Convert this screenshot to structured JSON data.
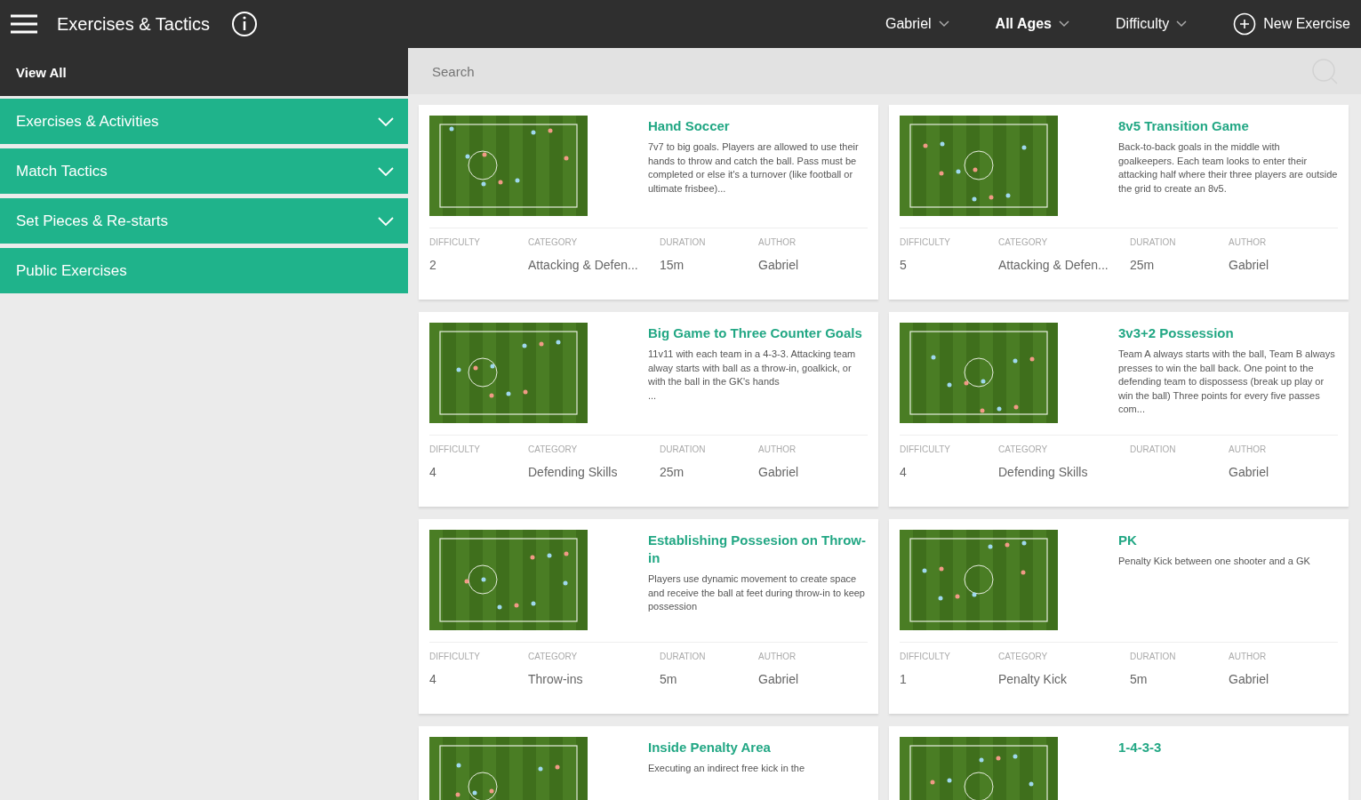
{
  "header": {
    "title": "Exercises & Tactics",
    "filters": [
      {
        "label": "Gabriel",
        "active": false
      },
      {
        "label": "All Ages",
        "active": true
      },
      {
        "label": "Difficulty",
        "active": false
      }
    ],
    "new_button": "New Exercise"
  },
  "sidebar": {
    "view_all": "View All",
    "items": [
      {
        "label": "Exercises & Activities",
        "kind": "group"
      },
      {
        "label": "Match Tactics",
        "kind": "group"
      },
      {
        "label": "Set Pieces & Re-starts",
        "kind": "group"
      },
      {
        "label": "Public Exercises",
        "kind": "link"
      }
    ]
  },
  "search": {
    "placeholder": "Search"
  },
  "cards": [
    {
      "title": "Hand Soccer",
      "description": "7v7 to big goals. Players are allowed to use their hands to throw and catch the ball. Pass must be completed or else it's a turnover (like football or ultimate frisbee)...",
      "fields": [
        {
          "label": "DIFFICULTY",
          "value": "2"
        },
        {
          "label": "CATEGORY",
          "value": "Attacking & Defen..."
        },
        {
          "label": "DURATION",
          "value": "15m"
        },
        {
          "label": "AUTHOR",
          "value": "Gabriel"
        }
      ]
    },
    {
      "title": "8v5 Transition Game",
      "description": "Back-to-back goals in the middle with goalkeepers. Each team looks to enter their attacking half where their three players are outside the grid to create an 8v5.",
      "fields": [
        {
          "label": "DIFFICULTY",
          "value": "5"
        },
        {
          "label": "CATEGORY",
          "value": "Attacking & Defen..."
        },
        {
          "label": "DURATION",
          "value": "25m"
        },
        {
          "label": "AUTHOR",
          "value": "Gabriel"
        }
      ]
    },
    {
      "title": "Big Game to Three Counter Goals",
      "description": "11v11 with each team in a 4-3-3. Attacking team alway starts with ball as a throw-in, goalkick, or with the ball in the GK's hands\n...",
      "fields": [
        {
          "label": "DIFFICULTY",
          "value": "4"
        },
        {
          "label": "CATEGORY",
          "value": "Defending Skills"
        },
        {
          "label": "DURATION",
          "value": "25m"
        },
        {
          "label": "AUTHOR",
          "value": "Gabriel"
        }
      ]
    },
    {
      "title": "3v3+2 Possession",
      "description": "Team A always starts with the ball, Team B always presses to win the ball back. One point to the defending team to dispossess (break up play or win the ball) Three points for every five passes com...",
      "fields": [
        {
          "label": "DIFFICULTY",
          "value": "4"
        },
        {
          "label": "CATEGORY",
          "value": "Defending Skills"
        },
        {
          "label": "DURATION"
        },
        {
          "label": "AUTHOR",
          "value": "Gabriel"
        }
      ]
    },
    {
      "title": "Establishing Possesion on Throw-in",
      "description": "Players use dynamic movement to create space and receive the ball at feet during throw-in to keep possession",
      "fields": [
        {
          "label": "DIFFICULTY",
          "value": "4"
        },
        {
          "label": "CATEGORY",
          "value": "Throw-ins"
        },
        {
          "label": "DURATION",
          "value": "5m"
        },
        {
          "label": "AUTHOR",
          "value": "Gabriel"
        }
      ]
    },
    {
      "title": "PK",
      "description": "Penalty Kick between one shooter and a GK",
      "fields": [
        {
          "label": "DIFFICULTY",
          "value": "1"
        },
        {
          "label": "CATEGORY",
          "value": "Penalty Kick"
        },
        {
          "label": "DURATION",
          "value": "5m"
        },
        {
          "label": "AUTHOR",
          "value": "Gabriel"
        }
      ]
    },
    {
      "title": "Inside Penalty Area",
      "description": "Executing an indirect free kick in the"
    },
    {
      "title": "1-4-3-3"
    }
  ]
}
